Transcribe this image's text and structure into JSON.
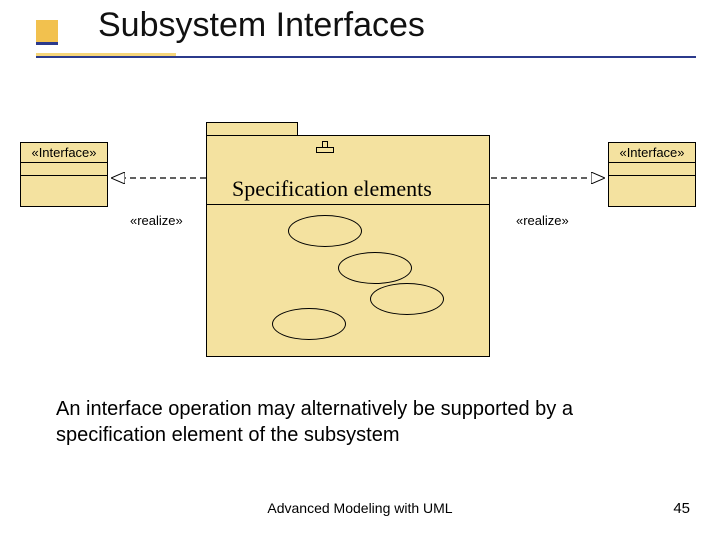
{
  "title": "Subsystem Interfaces",
  "interface_stereotype": "«Interface»",
  "realize_label": "«realize»",
  "subsystem_section": "Specification elements",
  "caption": "An interface operation may alternatively be supported by a specification element of the subsystem",
  "footer": "Advanced Modeling with UML",
  "page_number": "45"
}
